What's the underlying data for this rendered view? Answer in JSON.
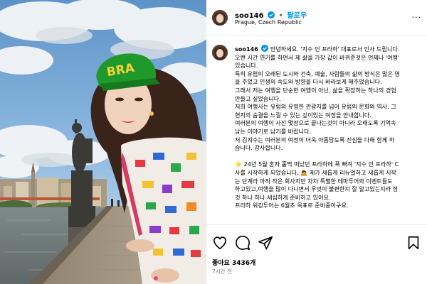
{
  "post": {
    "username": "soo146",
    "follow_label": "팔로우",
    "location": "Prague, Czech Republic",
    "dot": "•",
    "more_label": "···",
    "cap_text_color": "#000000",
    "verified_color": "#0095f6",
    "follow_color": "#0095f6"
  },
  "photo": {
    "cap_text": "BRA",
    "cap_color": "#1f9a2a"
  },
  "caption": {
    "lines": [
      "안녕하세요. '지수 인 프라하' 대표로서 인사 드립니다.",
      "오랜 시간 연기를 하면서 제 삶을 가장 값이 바뀌준것은 언제나 '여행'",
      "있습니다.",
      "특히 유럽의 오래된 도시와 건축, 예술, 사람들의 삶의 방식은 많은 영",
      "을 주었고 인생의 속도와 방향을 다시 바라보게 해주었습니다.",
      "그래서 저는 여행을 단순한 여행이 아닌, 삶을 확장하는 하나의 경험",
      "만들고 싶었습니다.",
      "저희 여행사는 유럽의 유명한 관광지를 넘어 유럽의 문화와 역사, 그",
      "현지의 숨결을 느낄 수 있는 깊이있는 여정을 안내합니다.",
      "여러분의 여행이 사진 몇장으로 끝나는것이 아니라 오래도록 기억속",
      "남는 이야기로 남기를 바랍니다.",
      "저 김지수는 여러분의 여정이 더욱 아름답도록 진심을 다해 함께 하",
      "습니다. 감사합니다.",
      "",
      "24년 5월 혼자 훌쩍 떠났던 프라하에 푹 빠져 '지수 인 프라하' C",
      "사를 시작하게 되었습니다. 🙇 제가 새롭게 리뉴얼하고 새롭게 시작",
      "는 단계라 아직 작은 회사지만 차차 특별한 테마투어와 이벤트들도",
      "하고있고,여행을 많이 다니면서 무엇이 불편한지 잘 알고있는지라 정",
      "것 하나 하나 세심하게 준비하고 있어요.",
      "프라하 워킹투어는 6월초 목표로 준비중이구요."
    ]
  },
  "actions": {
    "likes_label": "좋아요 3436개",
    "time_label": "7시간 전"
  }
}
